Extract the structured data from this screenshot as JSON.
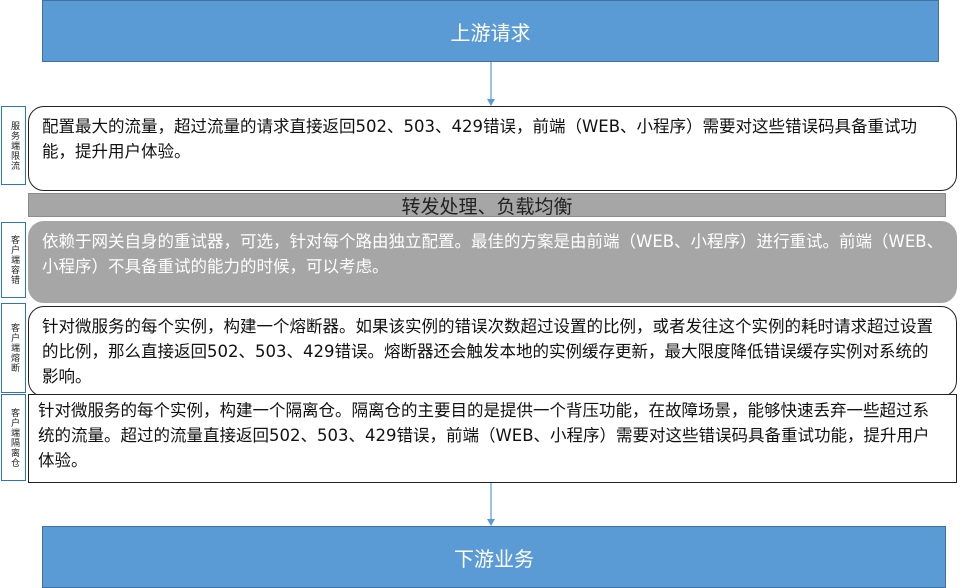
{
  "upstream": {
    "label": "上游请求"
  },
  "downstream": {
    "label": "下游业务"
  },
  "forwarding": {
    "label": "转发处理、负载均衡"
  },
  "steps": [
    {
      "side_label": "服务端限流",
      "text": "配置最大的流量，超过流量的请求直接返回502、503、429错误，前端（WEB、小程序）需要对这些错误码具备重试功能，提升用户体验。"
    },
    {
      "side_label": "客户端容错",
      "text": "依赖于网关自身的重试器，可选，针对每个路由独立配置。最佳的方案是由前端（WEB、小程序）进行重试。前端（WEB、小程序）不具备重试的能力的时候，可以考虑。"
    },
    {
      "side_label": "客户端熔断",
      "text": "针对微服务的每个实例，构建一个熔断器。如果该实例的错误次数超过设置的比例，或者发往这个实例的耗时请求超过设置的比例，那么直接返回502、503、429错误。熔断器还会触发本地的实例缓存更新，最大限度降低错误缓存实例对系统的影响。"
    },
    {
      "side_label": "客户端隔离仓",
      "text": "针对微服务的每个实例，构建一个隔离仓。隔离仓的主要目的是提供一个背压功能，在故障场景，能够快速丢弃一些超过系统的流量。超过的流量直接返回502、503、429错误，前端（WEB、小程序）需要对这些错误码具备重试功能，提升用户体验。"
    }
  ],
  "colors": {
    "blue": "#5b9bd5",
    "grey": "#a6a6a6",
    "border": "#2e75b6"
  }
}
